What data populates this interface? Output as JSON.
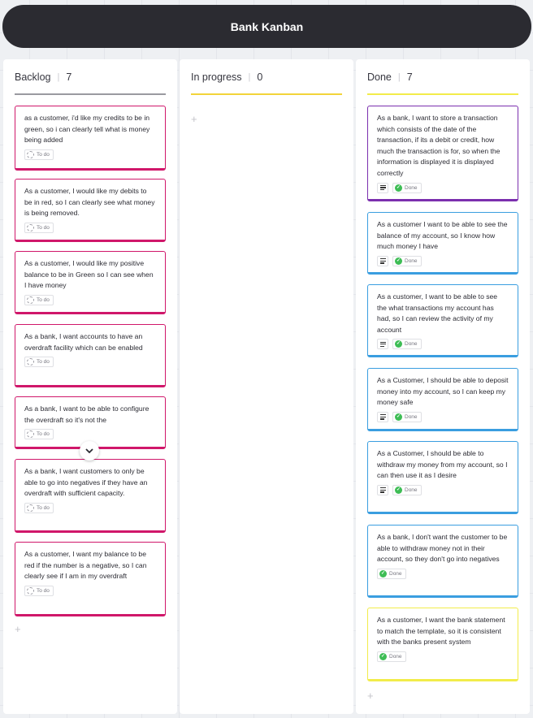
{
  "board": {
    "title": "Bank Kanban"
  },
  "columns": [
    {
      "name": "Backlog",
      "count": "7",
      "line_color": "#9a9aa0",
      "cards": [
        {
          "text": "as a customer, i'd like my credits to be in green, so i can clearly tell what is money being added",
          "status": "To do"
        },
        {
          "text": "As a customer, I would like my debits to be in red, so I can clearly see what money is being removed.",
          "status": "To do"
        },
        {
          "text": "As a customer, I would like my positive balance to be in Green so I can see when I have money",
          "status": "To do"
        },
        {
          "text": "As a bank, I want accounts to have an overdraft facility which can be enabled",
          "status": "To do"
        },
        {
          "text": "As a bank, I want to be able to configure the overdraft so it's not the",
          "status": "To do"
        },
        {
          "text": "As a bank, I want customers to only be able to go into negatives if they have an overdraft with sufficient capacity.",
          "status": "To do"
        },
        {
          "text": "As a customer, I want my balance to be red if the number is a negative, so I can clearly see if I am in my overdraft",
          "status": "To do"
        }
      ],
      "card_color": "#d0176a"
    },
    {
      "name": "In progress",
      "count": "0",
      "line_color": "#f2d43a",
      "cards": []
    },
    {
      "name": "Done",
      "count": "7",
      "line_color": "#f2ec4a",
      "cards": [
        {
          "text": "As a bank, I want to store a transaction which consists of the date of the transaction, if its a debit or credit, how much the transaction is for, so when the information is displayed it is displayed correctly",
          "status": "Done",
          "color": "#7b2fae"
        },
        {
          "text": "As a customer I want to be able to see the balance of my account, so I know how much money I have",
          "status": "Done",
          "color": "#3a9ee0"
        },
        {
          "text": "As a customer, I want to be able to see the what transactions my account has had, so I can review the activity of my account",
          "status": "Done",
          "color": "#3a9ee0"
        },
        {
          "text": "As a Customer, I should be able to deposit money into my account, so I can keep my money safe",
          "status": "Done",
          "color": "#3a9ee0"
        },
        {
          "text": "As a Customer, I should be able to withdraw my money from my account, so I can then use it as I desire",
          "status": "Done",
          "color": "#3a9ee0"
        },
        {
          "text": "As a bank, I don't want the customer to be able to withdraw money not in their account, so they don't go into negatives",
          "status": "Done",
          "color": "#3a9ee0"
        },
        {
          "text": "As a customer, I want the bank statement to match the template, so it is consistent with the banks present system",
          "status": "Done",
          "color": "#f2ec4a"
        }
      ]
    }
  ],
  "icons": {
    "add": "+",
    "expand": "⌄",
    "check": "✓"
  }
}
